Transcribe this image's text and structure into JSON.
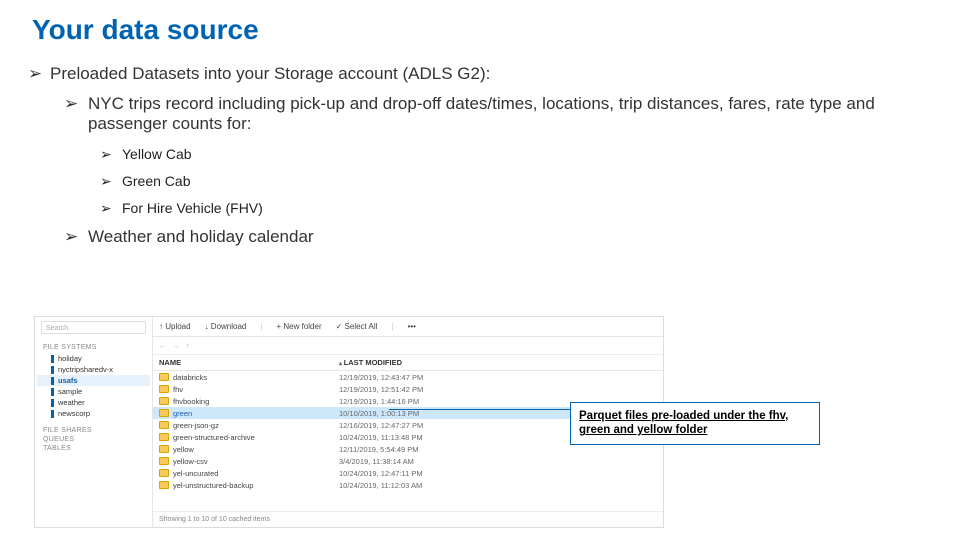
{
  "title": "Your data source",
  "bullets": {
    "lvl1": "Preloaded Datasets into your Storage account (ADLS G2):",
    "lvl2a": "NYC trips record including pick-up and drop-off dates/times, locations, trip distances, fares, rate type and passenger counts for:",
    "lvl3": {
      "a": "Yellow Cab",
      "b": "Green Cab",
      "c": "For Hire Vehicle (FHV)"
    },
    "lvl2b": "Weather and holiday calendar"
  },
  "explorer": {
    "search_placeholder": "Search",
    "toolbar": {
      "upload": "↑  Upload",
      "download": "↓  Download",
      "newfolder": "+ New folder",
      "selectall": "✓ Select All",
      "more": "•••"
    },
    "crumb": {
      "back": "←",
      "fwd": "→",
      "up": "↑"
    },
    "side_groups": {
      "fs_label": "FILE SYSTEMS",
      "fs_items": [
        "holiday",
        "nyctripsharedv-x",
        "usafs",
        "sample",
        "weather",
        "newscorp"
      ],
      "fs_selected": 2,
      "share_label": "FILE SHARES",
      "queues_label": "QUEUES",
      "tables_label": "TABLES"
    },
    "cols": {
      "name": "NAME",
      "modified": "LAST MODIFIED"
    },
    "rows": [
      {
        "name": "databricks",
        "mod": "12/19/2019, 12:43:47 PM",
        "type": "folder"
      },
      {
        "name": "fhv",
        "mod": "12/19/2019, 12:51:42 PM",
        "type": "folder"
      },
      {
        "name": "fhvbooking",
        "mod": "12/19/2019, 1:44:16 PM",
        "type": "folder"
      },
      {
        "name": "green",
        "mod": "10/10/2019, 1:00:13 PM",
        "type": "folder",
        "selected": true
      },
      {
        "name": "green-json-gz",
        "mod": "12/16/2019, 12:47:27 PM",
        "type": "folder"
      },
      {
        "name": "green-structured-archive",
        "mod": "10/24/2019, 11:13:48 PM",
        "type": "folder"
      },
      {
        "name": "yellow",
        "mod": "12/11/2019, 5:54:49 PM",
        "type": "folder"
      },
      {
        "name": "yellow-csv",
        "mod": "3/4/2019, 11:38:14 AM",
        "type": "folder"
      },
      {
        "name": "yel-uncurated",
        "mod": "10/24/2019, 12:47:11 PM",
        "type": "folder"
      },
      {
        "name": "yel-unstructured-backup",
        "mod": "10/24/2019, 11:12:03 AM",
        "type": "folder"
      }
    ],
    "footer": "Showing 1 to 10 of 10 cached items"
  },
  "callout": "Parquet files pre-loaded under the fhv, green and yellow folder"
}
